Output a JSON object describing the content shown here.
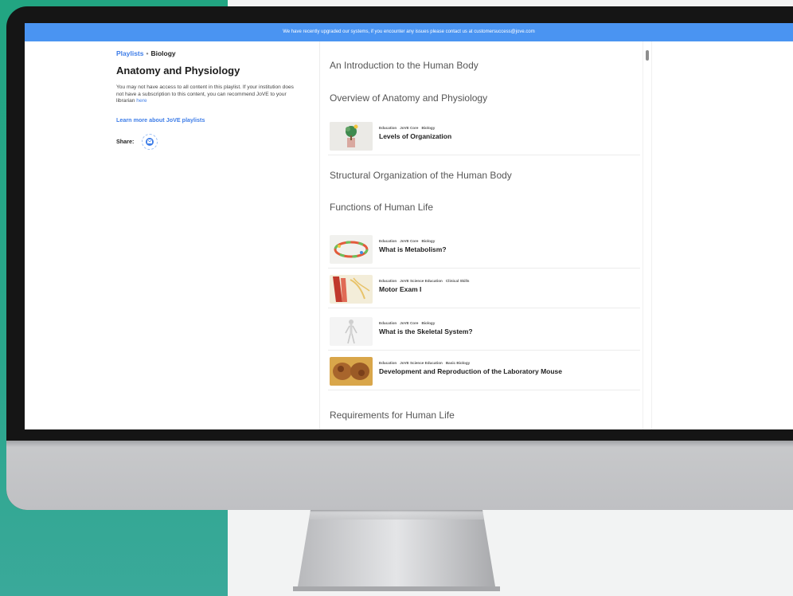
{
  "banner": {
    "text": "We have recently upgraded our systems, if you encounter any issues please contact us at ",
    "email": "customersuccess@jove.com"
  },
  "breadcrumb": {
    "parent": "Playlists",
    "separator": "•",
    "current": "Biology"
  },
  "page_title": "Anatomy and Physiology",
  "access_note": {
    "text": "You may not have access to all content in this playlist. If your institution does not have a subscription to this content, you can recommend JoVE to your librarian ",
    "link": "here"
  },
  "learn_more": "Learn more about JoVE playlists",
  "share": {
    "label": "Share:",
    "icon": "mail-icon"
  },
  "sections": [
    "An Introduction to the Human Body",
    "Overview of Anatomy and Physiology",
    "Structural Organization of the Human Body",
    "Functions of Human Life",
    "Requirements for Human Life"
  ],
  "items": [
    {
      "tags": [
        "Education",
        "JoVE Core",
        "Biology"
      ],
      "title": "Levels of Organization",
      "thumb_color": "#e4e4e1"
    },
    {
      "tags": [
        "Education",
        "JoVE Core",
        "Biology"
      ],
      "title": "What is Metabolism?",
      "thumb_color": "#f1f1ee"
    },
    {
      "tags": [
        "Education",
        "JoVE Science Education",
        "Clinical Skills"
      ],
      "title": "Motor Exam I",
      "thumb_color": "#efe9d6"
    },
    {
      "tags": [
        "Education",
        "JoVE Core",
        "Biology"
      ],
      "title": "What is the Skeletal System?",
      "thumb_color": "#f2f2f2"
    },
    {
      "tags": [
        "Education",
        "JoVE Science Education",
        "Basic Biology"
      ],
      "title": "Development and Reproduction of the Laboratory Mouse",
      "thumb_color": "#d9a64a"
    }
  ],
  "colors": {
    "banner": "#4a94f2",
    "link": "#3f7ee8",
    "left_panel": "#22a582"
  }
}
